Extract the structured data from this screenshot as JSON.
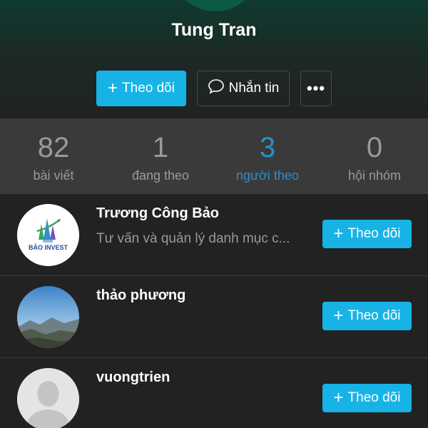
{
  "profile": {
    "name": "Tung Tran",
    "follow_label": "Theo dõi",
    "message_label": "Nhắn tin",
    "more_label": "•••"
  },
  "stats": [
    {
      "value": "82",
      "label": "bài viết",
      "active": false
    },
    {
      "value": "1",
      "label": "đang theo",
      "active": false
    },
    {
      "value": "3",
      "label": "người theo",
      "active": true
    },
    {
      "value": "0",
      "label": "hội nhóm",
      "active": false
    }
  ],
  "followers": [
    {
      "name": "Trương Công Bảo",
      "description": "Tư vấn và quản lý danh mục c...",
      "follow_label": "Theo dõi",
      "avatar": "bao-invest-logo"
    },
    {
      "name": "thảo phương",
      "description": "",
      "follow_label": "Theo dõi",
      "avatar": "landscape-photo"
    },
    {
      "name": "vuongtrien",
      "description": "",
      "follow_label": "Theo dõi",
      "avatar": "default-user-silhouette"
    }
  ],
  "logo_text": "BẢO INVEST",
  "colors": {
    "accent": "#17b3e6",
    "active_stat": "#2a8fc9",
    "background": "#222222",
    "stats_bar": "#3a3a3a"
  }
}
